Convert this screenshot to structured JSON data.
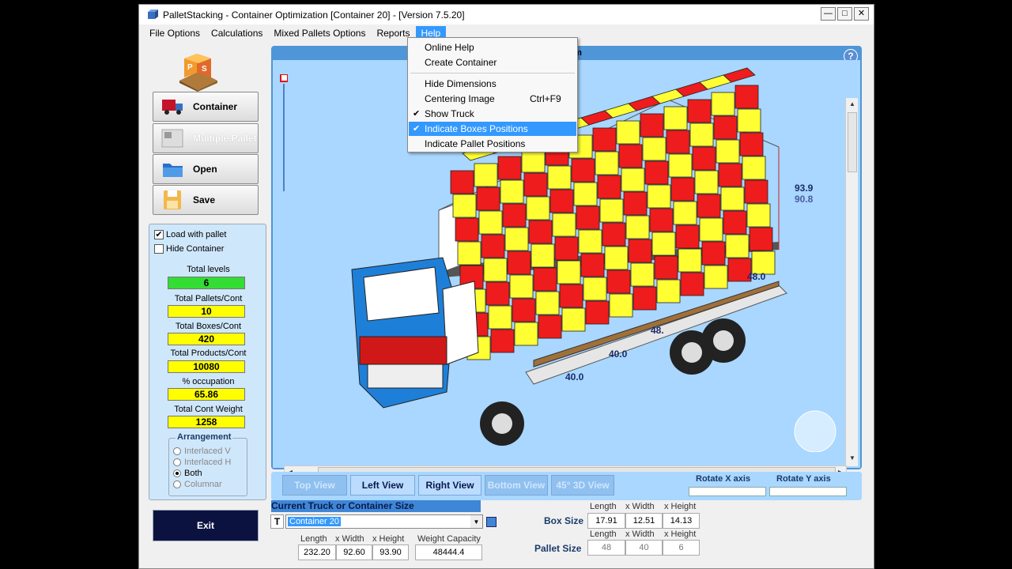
{
  "window": {
    "title": "PalletStacking - Container Optimization [Container 20] - [Version 7.5.20]"
  },
  "menubar": [
    "File Options",
    "Calculations",
    "Mixed Pallets Options",
    "Reports",
    "Help"
  ],
  "help_menu": {
    "items": [
      {
        "label": "Online Help",
        "checked": false,
        "shortcut": ""
      },
      {
        "label": "Create Container",
        "checked": false,
        "shortcut": ""
      },
      {
        "label": "Hide Dimensions",
        "checked": false,
        "shortcut": ""
      },
      {
        "label": "Centering Image",
        "checked": false,
        "shortcut": "Ctrl+F9"
      },
      {
        "label": "Show Truck",
        "checked": true,
        "shortcut": ""
      },
      {
        "label": "Indicate Boxes Positions",
        "checked": true,
        "shortcut": "",
        "highlighted": true
      },
      {
        "label": "Indicate Pallet Positions",
        "checked": false,
        "shortcut": ""
      }
    ]
  },
  "left_buttons": {
    "container": "Container",
    "multiple_pallet": "Multiple Pallet",
    "open": "Open",
    "save": "Save",
    "exit": "Exit"
  },
  "options": {
    "load_with_pallet": {
      "label": "Load with pallet",
      "checked": true
    },
    "hide_container": {
      "label": "Hide Container",
      "checked": false
    }
  },
  "stats": [
    {
      "label": "Total levels",
      "value": "6"
    },
    {
      "label": "Total Pallets/Cont",
      "value": "10"
    },
    {
      "label": "Total Boxes/Cont",
      "value": "420"
    },
    {
      "label": "Total Products/Cont",
      "value": "10080"
    },
    {
      "label": "% occupation",
      "value": "65.86"
    },
    {
      "label": "Total Cont Weight",
      "value": "1258"
    }
  ],
  "arrangement": {
    "title": "Arrangement",
    "options": [
      "Interlaced V",
      "Interlaced H",
      "Both",
      "Columnar"
    ],
    "selected": "Both"
  },
  "view": {
    "header_fragment": "em",
    "dimensions": {
      "height_outer": "93.9",
      "height_inner": "90.8",
      "depth": "48.0",
      "side": "48.",
      "pallet_a": "40.0",
      "pallet_b": "40.0"
    },
    "colors": {
      "box_red": "#ee1c1c",
      "box_yellow": "#ffff33",
      "truck_blue": "#1e7fd8",
      "background": "#a9d7ff"
    }
  },
  "view_buttons": [
    "Top View",
    "Left View",
    "Right View",
    "Bottom View",
    "45° 3D View"
  ],
  "rotate": {
    "x_label": "Rotate X axis",
    "y_label": "Rotate Y axis"
  },
  "container": {
    "section_title": "Current Truck or Container Size",
    "type_letter": "T",
    "selected": "Container 20",
    "headers": {
      "length": "Length",
      "width": "x Width",
      "height": "x Height",
      "capacity": "Weight Capacity"
    },
    "length": "232.20",
    "width": "92.60",
    "height": "93.90",
    "capacity": "48444.4"
  },
  "box_size": {
    "label": "Box Size",
    "length": "17.91",
    "width": "12.51",
    "height": "14.13"
  },
  "pallet_size": {
    "label": "Pallet Size",
    "length": "48",
    "width": "40",
    "height": "6"
  },
  "size_headers": {
    "length": "Length",
    "width": "x Width",
    "height": "x Height"
  }
}
